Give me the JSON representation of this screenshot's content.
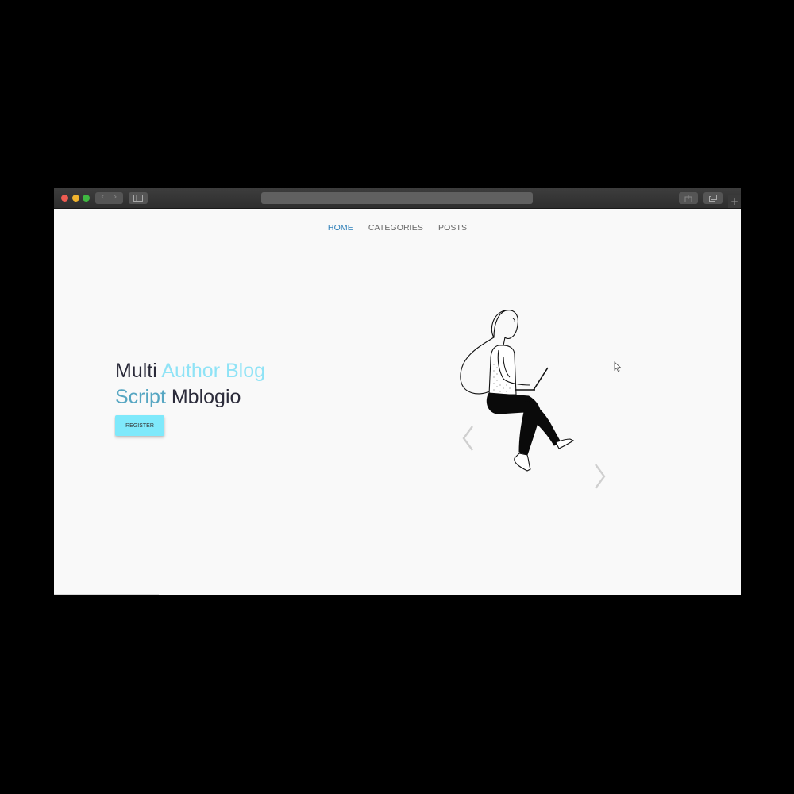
{
  "nav": {
    "home": "HOME",
    "categories": "CATEGORIES",
    "posts": "POSTS"
  },
  "hero": {
    "title_part1": "Multi ",
    "title_part2": "Author Blog",
    "title_part3": "Script",
    "title_part4": " Mblogio",
    "register_label": "REGISTER"
  },
  "colors": {
    "accent_light": "#8fe3f6",
    "accent_mid": "#56a6c2",
    "nav_active": "#2e7fb8",
    "button_bg": "#7fe9fb"
  },
  "icons": {
    "close": "red-dot",
    "minimize": "yellow-dot",
    "zoom": "green-dot",
    "slider_prev": "chevron-left-icon",
    "slider_next": "chevron-right-icon"
  }
}
